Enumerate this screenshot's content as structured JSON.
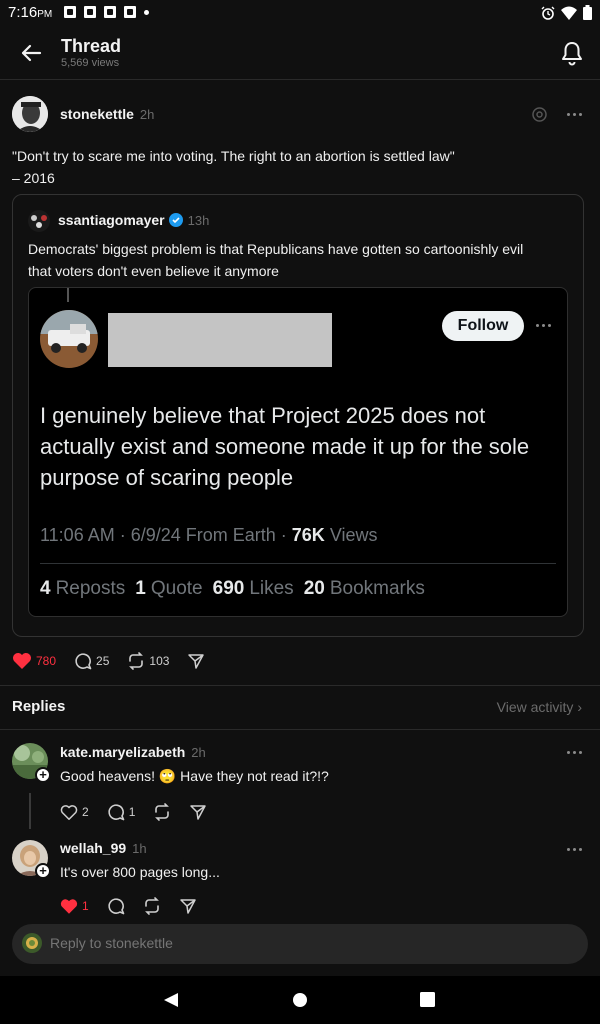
{
  "status_bar": {
    "time": "7:16",
    "ampm": "PM"
  },
  "header": {
    "title": "Thread",
    "views": "5,569 views"
  },
  "main_post": {
    "username": "stonekettle",
    "time": "2h",
    "text_line1": "\"Don't try to scare me into voting. The right to an abortion is settled law\"",
    "text_line2": "– 2016",
    "likes": "780",
    "comments": "25",
    "reposts": "103"
  },
  "quoted_post": {
    "username": "ssantiagomayer",
    "time": "13h",
    "text_line1": "Democrats' biggest problem is that Republicans have gotten so cartoonishly evil",
    "text_line2": "that voters don't even believe it anymore"
  },
  "embedded_tweet": {
    "follow_label": "Follow",
    "text": "I genuinely believe that Project 2025 does not actually exist and someone made it up for the sole purpose of scaring people",
    "meta_prefix": "11:06 AM · 6/9/24 From Earth · ",
    "views_count": "76K",
    "views_label": " Views",
    "stats": [
      {
        "count": "4",
        "label": "Reposts"
      },
      {
        "count": "1",
        "label": "Quote"
      },
      {
        "count": "690",
        "label": "Likes"
      },
      {
        "count": "20",
        "label": "Bookmarks"
      }
    ]
  },
  "replies_section": {
    "title": "Replies",
    "view_activity": "View activity"
  },
  "replies": [
    {
      "username": "kate.maryelizabeth",
      "time": "2h",
      "text": "Good heavens! 🙄 Have they not read it?!?",
      "likes": "2",
      "comments": "1"
    },
    {
      "username": "wellah_99",
      "time": "1h",
      "text": "It's over 800 pages long...",
      "likes": "1"
    }
  ],
  "reply_bar": {
    "placeholder": "Reply to stonekettle"
  },
  "colors": {
    "background": "#101010",
    "like_red": "#ff3040",
    "verified_blue": "#1d9bf0"
  }
}
